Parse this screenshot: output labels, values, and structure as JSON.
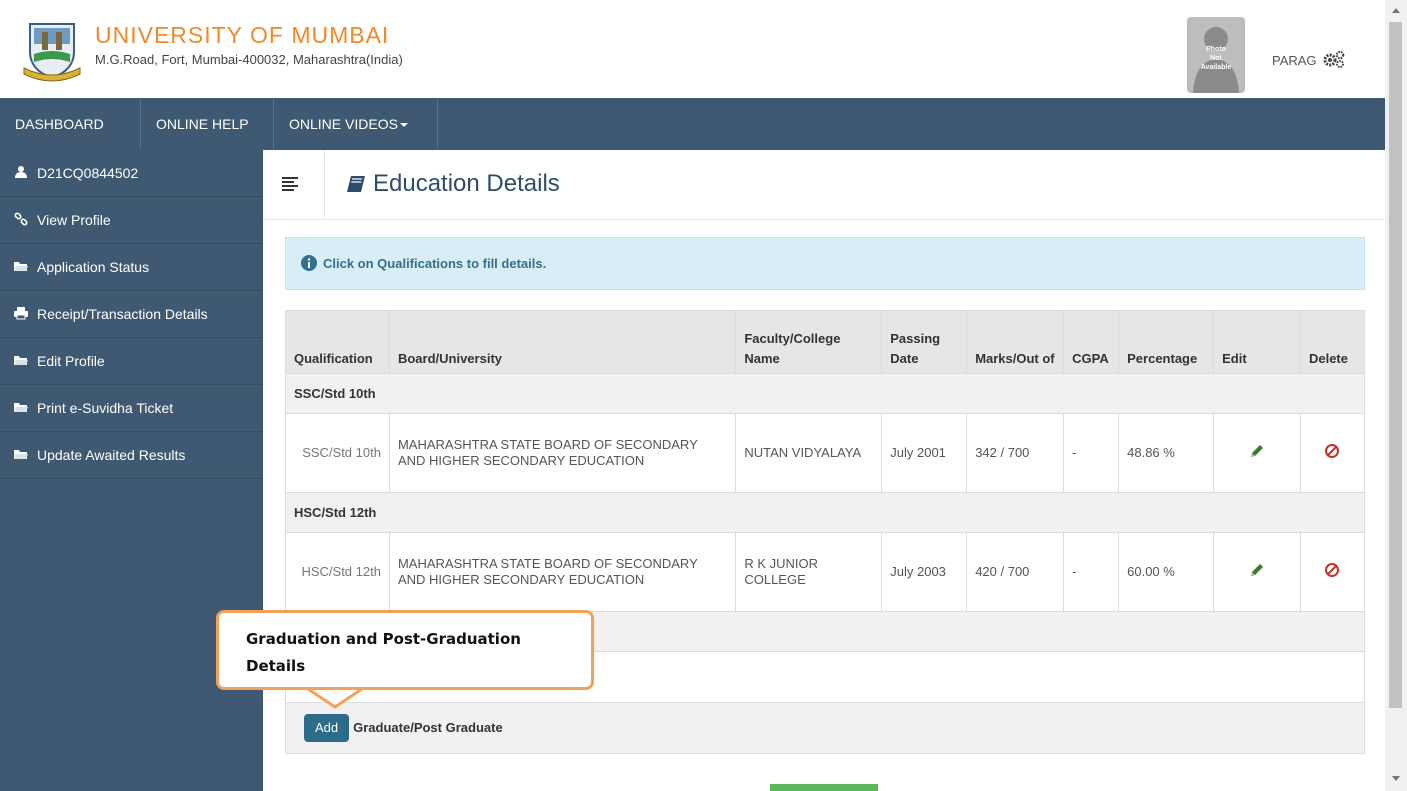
{
  "header": {
    "title": "UNIVERSITY OF MUMBAI",
    "address": "M.G.Road, Fort, Mumbai-400032, Maharashtra(India)",
    "photo_text": "Photo\nNot\nAvailable",
    "user_name": "PARAG",
    "logo_icon": "university-crest-icon",
    "settings_icon": "gears-icon"
  },
  "nav": {
    "items": [
      {
        "label": "DASHBOARD"
      },
      {
        "label": "ONLINE HELP"
      },
      {
        "label": "ONLINE VIDEOS"
      }
    ]
  },
  "sidebar": {
    "items": [
      {
        "label": "D21CQ0844502",
        "icon": "user-icon"
      },
      {
        "label": "View Profile",
        "icon": "link-icon"
      },
      {
        "label": "Application Status",
        "icon": "folder-icon"
      },
      {
        "label": "Receipt/Transaction Details",
        "icon": "print-icon"
      },
      {
        "label": "Edit Profile",
        "icon": "folder-icon"
      },
      {
        "label": "Print e-Suvidha Ticket",
        "icon": "folder-icon"
      },
      {
        "label": "Update Awaited Results",
        "icon": "folder-icon"
      }
    ]
  },
  "page": {
    "title": "Education Details",
    "alert": "Click on Qualifications to fill details."
  },
  "table": {
    "headers": [
      "Qualification",
      "Board/University",
      "Faculty/College Name",
      "Passing Date",
      "Marks/Out of",
      "CGPA",
      "Percentage",
      "Edit",
      "Delete"
    ],
    "groups": [
      {
        "group": "SSC/Std 10th",
        "row": {
          "qualification": "SSC/Std 10th",
          "board": "MAHARASHTRA STATE BOARD OF SECONDARY AND HIGHER SECONDARY EDUCATION",
          "college": "NUTAN VIDYALAYA",
          "passing_date": "July 2001",
          "marks": "342 / 700",
          "cgpa": "-",
          "percentage": "48.86 %"
        }
      },
      {
        "group": "HSC/Std 12th",
        "row": {
          "qualification": "HSC/Std 12th",
          "board": "MAHARASHTRA STATE BOARD OF SECONDARY AND HIGHER SECONDARY EDUCATION",
          "college": "R K JUNIOR COLLEGE",
          "passing_date": "July 2003",
          "marks": "420 / 700",
          "cgpa": "-",
          "percentage": "60.00 %"
        }
      }
    ],
    "add_button": "Add",
    "add_label": "Graduate/Post Graduate"
  },
  "callout": {
    "text": "Graduation and Post-Graduation Details"
  },
  "colors": {
    "brand_orange": "#f0892a",
    "nav_bg": "#3f5973",
    "alert_bg": "#d9edf7",
    "edit_green": "#3c7a2c",
    "delete_red": "#c9302c",
    "add_button": "#2e6b8a"
  }
}
